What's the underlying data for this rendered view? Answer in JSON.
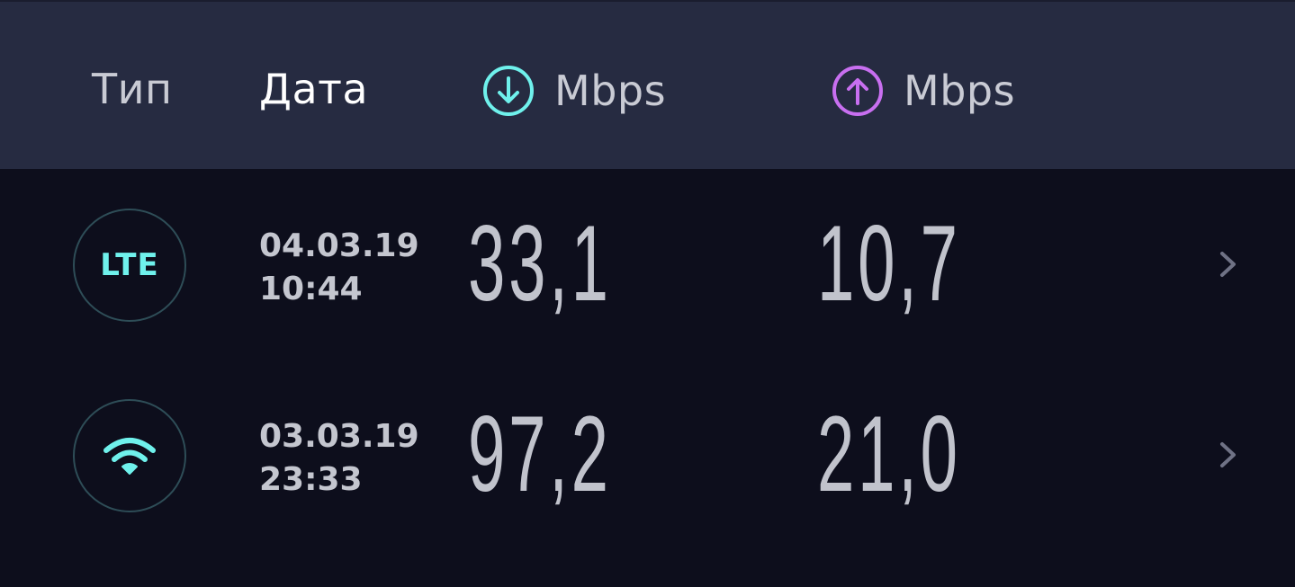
{
  "header": {
    "type_label": "Тип",
    "date_label": "Дата",
    "download": {
      "icon": "download-arrow-icon",
      "unit": "Mbps",
      "color": "#6ff1ec"
    },
    "upload": {
      "icon": "upload-arrow-icon",
      "unit": "Mbps",
      "color": "#c86ff0"
    }
  },
  "results": [
    {
      "type": "LTE",
      "type_icon": "lte-icon",
      "date": "04.03.19",
      "time": "10:44",
      "download": "33,1",
      "upload": "10,7"
    },
    {
      "type_icon": "wifi-icon",
      "date": "03.03.19",
      "time": "23:33",
      "download": "97,2",
      "upload": "21,0"
    }
  ],
  "colors": {
    "background": "#0d0e1c",
    "header_bg": "#262b41",
    "accent": "#6ff1ec",
    "upload_accent": "#c86ff0"
  }
}
